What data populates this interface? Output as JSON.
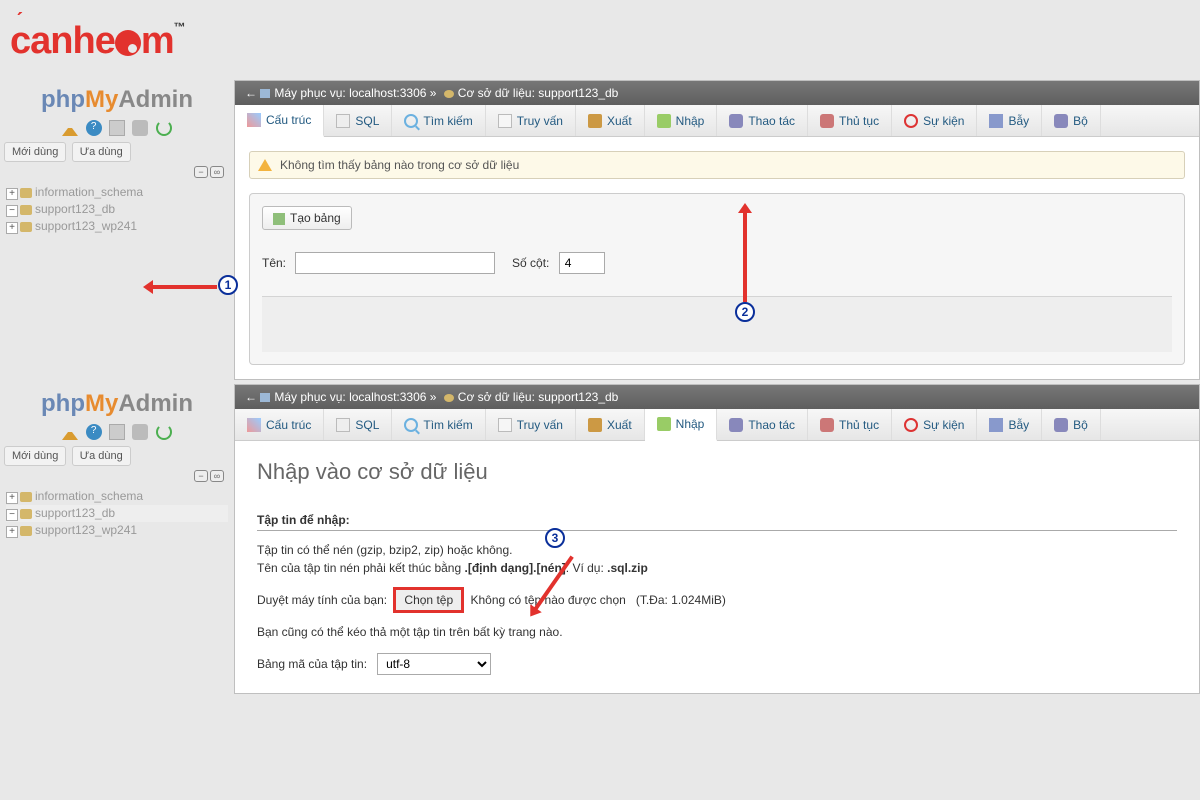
{
  "brand": "cánheam",
  "pma_logo": {
    "p1": "php",
    "p2": "My",
    "p3": "Admin"
  },
  "sidebar": {
    "tabs": {
      "recent": "Mới dùng",
      "favorite": "Ưa dùng"
    },
    "tree": [
      {
        "label": "information_schema",
        "pm": "+"
      },
      {
        "label": "support123_db",
        "pm": "−"
      },
      {
        "label": "support123_wp241",
        "pm": "+"
      }
    ]
  },
  "breadcrumb": {
    "server_label": "Máy phục vụ:",
    "server": "localhost:3306",
    "db_label": "Cơ sở dữ liệu:",
    "db": "support123_db"
  },
  "tabs": {
    "structure": "Cấu trúc",
    "sql": "SQL",
    "search": "Tìm kiếm",
    "query": "Truy vấn",
    "export": "Xuất",
    "import": "Nhập",
    "operations": "Thao tác",
    "routines": "Thủ tục",
    "events": "Sự kiện",
    "triggers": "Bẫy",
    "more": "Bộ"
  },
  "top_panel": {
    "notice": "Không tìm thấy bảng nào trong cơ sở dữ liệu",
    "create_btn": "Tạo bảng",
    "name_label": "Tên:",
    "cols_label": "Số cột:",
    "cols_value": "4"
  },
  "import_panel": {
    "heading": "Nhập vào cơ sở dữ liệu",
    "section": "Tập tin để nhập:",
    "line1": "Tập tin có thể nén (gzip, bzip2, zip) hoặc không.",
    "line2_a": "Tên của tập tin nén phải kết thúc bằng ",
    "line2_b": ".[định dạng].[nén]",
    "line2_c": ". Ví dụ: ",
    "line2_d": ".sql.zip",
    "browse_label": "Duyệt máy tính của bạn:",
    "choose_btn": "Chọn tệp",
    "no_file": "Không có tệp nào được chọn",
    "max": "(T.Đa: 1.024MiB)",
    "drag_hint": "Bạn cũng có thể kéo thả một tập tin trên bất kỳ trang nào.",
    "charset_label": "Bảng mã của tập tin:",
    "charset_value": "utf-8"
  },
  "badges": {
    "one": "1",
    "two": "2",
    "three": "3"
  }
}
